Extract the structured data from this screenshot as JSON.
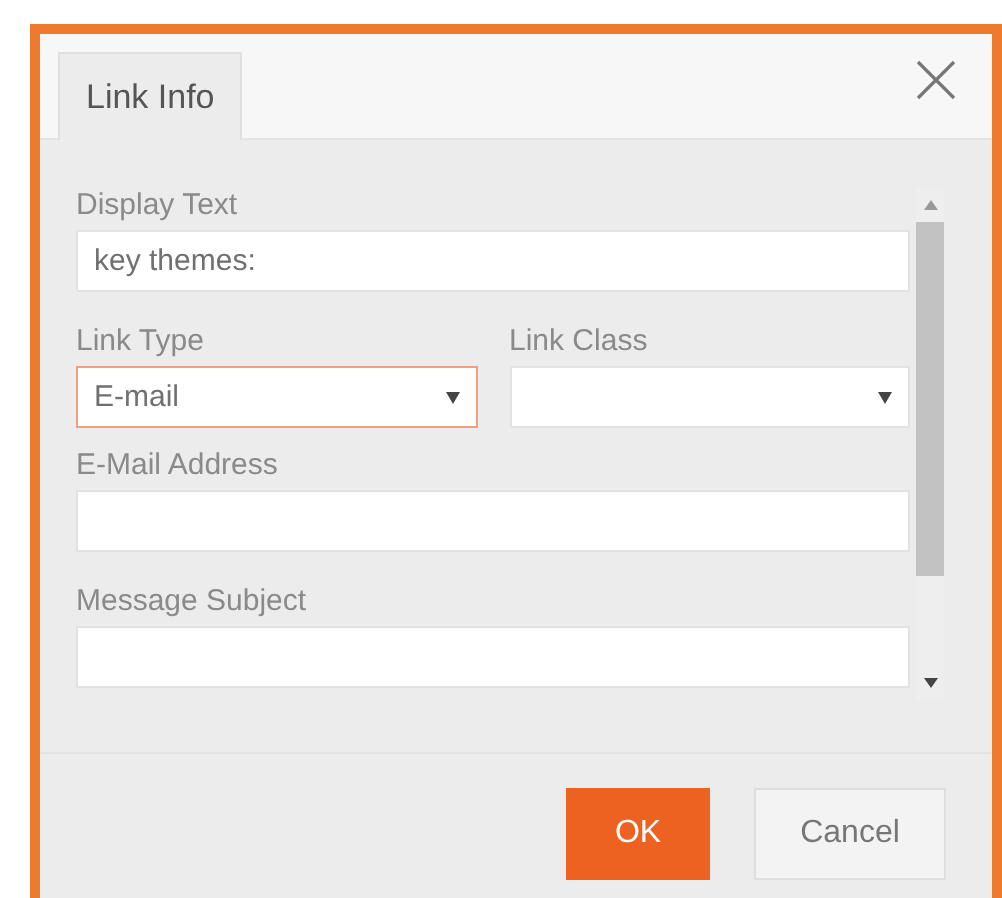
{
  "tabs": [
    {
      "label": "Link Info",
      "selected": true
    }
  ],
  "fields": [
    {
      "kind": "text",
      "label": "Display Text",
      "value": "key themes:",
      "focused": false
    },
    {
      "kind": "row",
      "children": [
        {
          "kind": "select",
          "label": "Link Type",
          "value": "E-mail",
          "focused": true
        },
        {
          "kind": "select",
          "label": "Link Class",
          "focused": false
        }
      ]
    },
    {
      "kind": "text",
      "label": "E-Mail Address",
      "focused": false
    },
    {
      "kind": "text",
      "label": "Message Subject",
      "focused": false
    }
  ],
  "buttons": [
    {
      "label": "OK",
      "kind": "primary"
    },
    {
      "label": "Cancel",
      "kind": "secondary"
    }
  ]
}
